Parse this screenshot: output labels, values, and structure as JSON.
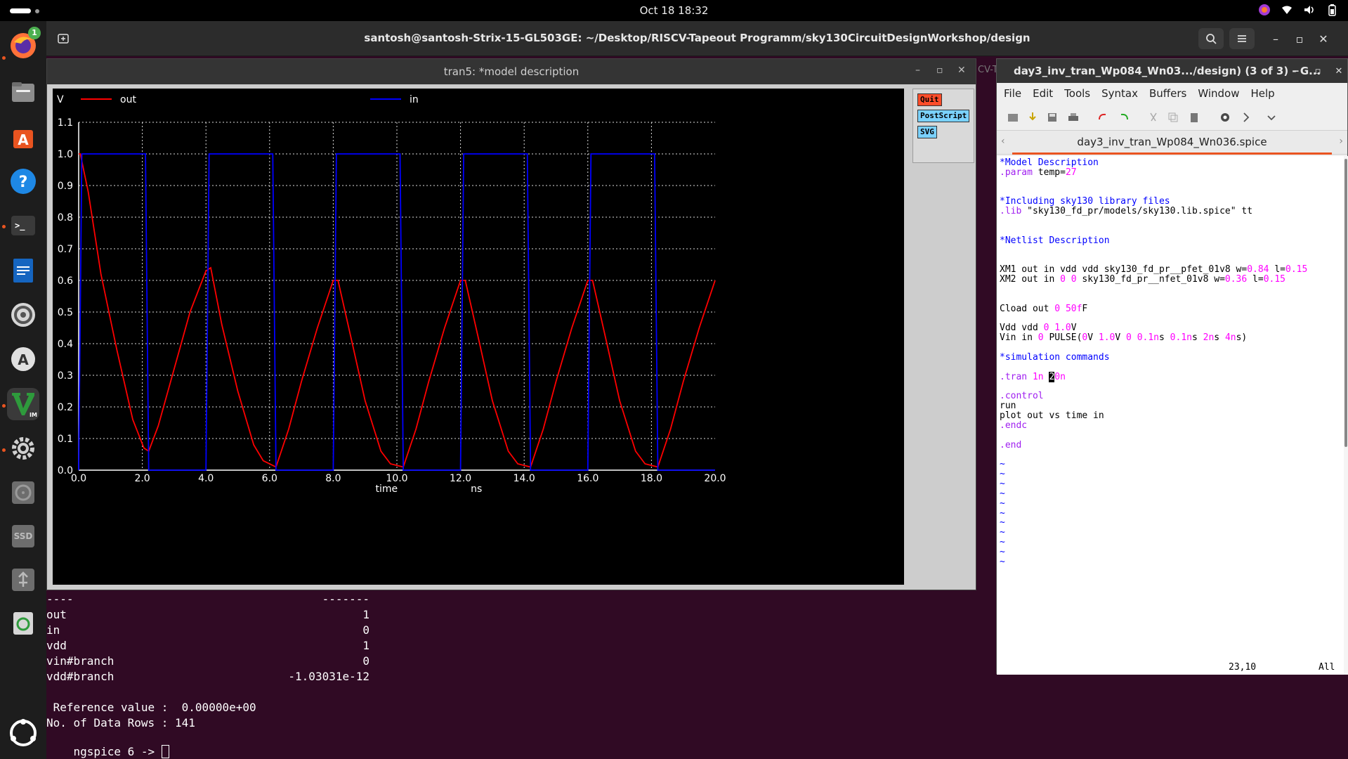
{
  "topbar": {
    "clock": "Oct 18  18:32",
    "tray_icons": [
      "firefox-indicator-icon",
      "wifi-icon",
      "volume-icon",
      "battery-icon"
    ]
  },
  "dock": {
    "items": [
      {
        "name": "firefox",
        "badge": "1"
      },
      {
        "name": "files"
      },
      {
        "name": "software-center"
      },
      {
        "name": "help"
      },
      {
        "name": "terminal"
      },
      {
        "name": "libreoffice-writer"
      },
      {
        "name": "settings-wheel"
      },
      {
        "name": "software-updater"
      },
      {
        "name": "vim"
      },
      {
        "name": "settings"
      },
      {
        "name": "disk"
      },
      {
        "name": "ssd",
        "label": "SSD"
      },
      {
        "name": "usb-drive"
      },
      {
        "name": "trash"
      },
      {
        "name": "show-apps"
      }
    ]
  },
  "terminal": {
    "title": "santosh@santosh-Strix-15-GL503GE: ~/Desktop/RISCV-Tapeout Programm/sky130CircuitDesignWorkshop/design",
    "behind_tab_fragment": "CV-T",
    "output": [
      {
        "name": "----",
        "value": "-------"
      },
      {
        "name": "out",
        "value": "1"
      },
      {
        "name": "in",
        "value": "0"
      },
      {
        "name": "vdd",
        "value": "1"
      },
      {
        "name": "vin#branch",
        "value": "0"
      },
      {
        "name": "vdd#branch",
        "value": "-1.03031e-12"
      }
    ],
    "reference_line": " Reference value :  0.00000e+00",
    "rows_line": "No. of Data Rows : 141",
    "prompt": "ngspice 6 -> "
  },
  "plot_window": {
    "title": "tran5: *model description",
    "buttons": {
      "quit": "Quit",
      "postscript": "PostScript",
      "svg": "SVG"
    }
  },
  "chart_data": {
    "type": "line",
    "ylabel": "V",
    "xlabel": "time",
    "xunit": "ns",
    "xlim": [
      0,
      20
    ],
    "ylim": [
      0,
      1.1
    ],
    "xticks": [
      "0.0",
      "2.0",
      "4.0",
      "6.0",
      "8.0",
      "10.0",
      "12.0",
      "14.0",
      "16.0",
      "18.0",
      "20.0"
    ],
    "yticks": [
      "0.0",
      "0.1",
      "0.2",
      "0.3",
      "0.4",
      "0.5",
      "0.6",
      "0.7",
      "0.8",
      "0.9",
      "1.0",
      "1.1"
    ],
    "grid": true,
    "legend_placement": "top",
    "series": [
      {
        "name": "out",
        "color": "#ff0000",
        "x": [
          0.0,
          0.05,
          0.3,
          0.7,
          1.2,
          1.7,
          2.05,
          2.2,
          2.5,
          3.0,
          3.5,
          4.0,
          4.15,
          4.5,
          5.0,
          5.5,
          5.8,
          6.2,
          6.6,
          7.0,
          7.5,
          8.0,
          8.15,
          8.6,
          9.0,
          9.5,
          9.8,
          10.2,
          10.6,
          11.0,
          11.5,
          12.0,
          12.15,
          12.6,
          13.0,
          13.5,
          13.8,
          14.2,
          14.6,
          15.0,
          15.5,
          16.0,
          16.15,
          16.6,
          17.0,
          17.5,
          17.8,
          18.2,
          18.6,
          19.0,
          19.5,
          20.0
        ],
        "y": [
          1.0,
          1.0,
          0.88,
          0.62,
          0.38,
          0.16,
          0.07,
          0.06,
          0.14,
          0.32,
          0.5,
          0.63,
          0.64,
          0.46,
          0.25,
          0.08,
          0.03,
          0.01,
          0.13,
          0.28,
          0.45,
          0.6,
          0.6,
          0.4,
          0.22,
          0.06,
          0.02,
          0.01,
          0.13,
          0.28,
          0.45,
          0.6,
          0.6,
          0.4,
          0.22,
          0.06,
          0.02,
          0.01,
          0.13,
          0.28,
          0.45,
          0.6,
          0.6,
          0.4,
          0.22,
          0.06,
          0.02,
          0.01,
          0.13,
          0.28,
          0.45,
          0.6
        ]
      },
      {
        "name": "in",
        "color": "#0000ff",
        "x": [
          0.0,
          0.1,
          2.1,
          2.2,
          4.0,
          4.1,
          6.1,
          6.2,
          8.0,
          8.1,
          10.1,
          10.2,
          12.0,
          12.1,
          14.1,
          14.2,
          16.0,
          16.1,
          18.1,
          18.2,
          20.0
        ],
        "y": [
          0.0,
          1.0,
          1.0,
          0.0,
          0.0,
          1.0,
          1.0,
          0.0,
          0.0,
          1.0,
          1.0,
          0.0,
          0.0,
          1.0,
          1.0,
          0.0,
          0.0,
          1.0,
          1.0,
          0.0,
          0.0
        ]
      }
    ]
  },
  "vim": {
    "title": "day3_inv_tran_Wp084_Wn03.../design) (3 of 3) - G...",
    "menu": [
      "File",
      "Edit",
      "Tools",
      "Syntax",
      "Buffers",
      "Window",
      "Help"
    ],
    "tab": "day3_inv_tran_Wp084_Wn036.spice",
    "status_pos": "23,10",
    "status_all": "All",
    "lines": [
      {
        "row": 0,
        "segs": [
          {
            "t": "*Model Description",
            "c": "c-com"
          }
        ]
      },
      {
        "row": 1,
        "segs": [
          {
            "t": ".param",
            "c": "c-kw"
          },
          {
            "t": " temp="
          },
          {
            "t": "27",
            "c": "c-num"
          }
        ]
      },
      {
        "row": 4,
        "segs": [
          {
            "t": "*Including sky130 library files",
            "c": "c-com"
          }
        ]
      },
      {
        "row": 5,
        "segs": [
          {
            "t": ".lib",
            "c": "c-kw"
          },
          {
            "t": " \"sky130_fd_pr/models/sky130.lib.spice\" tt"
          }
        ]
      },
      {
        "row": 8,
        "segs": [
          {
            "t": "*Netlist Description",
            "c": "c-com"
          }
        ]
      },
      {
        "row": 11,
        "segs": [
          {
            "t": "XM1 out in vdd vdd sky130_fd_pr__pfet_01v8 w="
          },
          {
            "t": "0.84",
            "c": "c-num"
          },
          {
            "t": " l="
          },
          {
            "t": "0.15",
            "c": "c-num"
          }
        ]
      },
      {
        "row": 12,
        "segs": [
          {
            "t": "XM2 out in "
          },
          {
            "t": "0",
            "c": "c-num"
          },
          {
            "t": " "
          },
          {
            "t": "0",
            "c": "c-num"
          },
          {
            "t": " sky130_fd_pr__nfet_01v8 w="
          },
          {
            "t": "0.36",
            "c": "c-num"
          },
          {
            "t": " l="
          },
          {
            "t": "0.15",
            "c": "c-num"
          }
        ]
      },
      {
        "row": 15,
        "segs": [
          {
            "t": "Cload out "
          },
          {
            "t": "0",
            "c": "c-num"
          },
          {
            "t": " "
          },
          {
            "t": "50f",
            "c": "c-num"
          },
          {
            "t": "F"
          }
        ]
      },
      {
        "row": 17,
        "segs": [
          {
            "t": "Vdd vdd "
          },
          {
            "t": "0",
            "c": "c-num"
          },
          {
            "t": " "
          },
          {
            "t": "1.0",
            "c": "c-num"
          },
          {
            "t": "V"
          }
        ]
      },
      {
        "row": 18,
        "segs": [
          {
            "t": "Vin in "
          },
          {
            "t": "0",
            "c": "c-num"
          },
          {
            "t": " PULSE("
          },
          {
            "t": "0",
            "c": "c-num"
          },
          {
            "t": "V "
          },
          {
            "t": "1.0",
            "c": "c-num"
          },
          {
            "t": "V "
          },
          {
            "t": "0",
            "c": "c-num"
          },
          {
            "t": " "
          },
          {
            "t": "0.1n",
            "c": "c-num"
          },
          {
            "t": "s "
          },
          {
            "t": "0.1n",
            "c": "c-num"
          },
          {
            "t": "s "
          },
          {
            "t": "2n",
            "c": "c-num"
          },
          {
            "t": "s "
          },
          {
            "t": "4n",
            "c": "c-num"
          },
          {
            "t": "s)"
          }
        ]
      },
      {
        "row": 20,
        "segs": [
          {
            "t": "*simulation commands",
            "c": "c-com"
          }
        ]
      },
      {
        "row": 22,
        "segs": [
          {
            "t": ".tran",
            "c": "c-kw"
          },
          {
            "t": " "
          },
          {
            "t": "1n",
            "c": "c-num"
          },
          {
            "t": " "
          },
          {
            "t": "2",
            "c": "cursor"
          },
          {
            "t": "0n",
            "c": "c-num"
          }
        ]
      },
      {
        "row": 24,
        "segs": [
          {
            "t": ".control",
            "c": "c-kw"
          }
        ]
      },
      {
        "row": 25,
        "segs": [
          {
            "t": "run"
          }
        ]
      },
      {
        "row": 26,
        "segs": [
          {
            "t": "plot out vs time in"
          }
        ]
      },
      {
        "row": 27,
        "segs": [
          {
            "t": ".endc",
            "c": "c-kw"
          }
        ]
      },
      {
        "row": 29,
        "segs": [
          {
            "t": ".end",
            "c": "c-kw"
          }
        ]
      },
      {
        "row": 31,
        "segs": [
          {
            "t": "~",
            "c": "c-tilde"
          }
        ]
      },
      {
        "row": 32,
        "segs": [
          {
            "t": "~",
            "c": "c-tilde"
          }
        ]
      },
      {
        "row": 33,
        "segs": [
          {
            "t": "~",
            "c": "c-tilde"
          }
        ]
      },
      {
        "row": 34,
        "segs": [
          {
            "t": "~",
            "c": "c-tilde"
          }
        ]
      },
      {
        "row": 35,
        "segs": [
          {
            "t": "~",
            "c": "c-tilde"
          }
        ]
      },
      {
        "row": 36,
        "segs": [
          {
            "t": "~",
            "c": "c-tilde"
          }
        ]
      },
      {
        "row": 37,
        "segs": [
          {
            "t": "~",
            "c": "c-tilde"
          }
        ]
      },
      {
        "row": 38,
        "segs": [
          {
            "t": "~",
            "c": "c-tilde"
          }
        ]
      },
      {
        "row": 39,
        "segs": [
          {
            "t": "~",
            "c": "c-tilde"
          }
        ]
      },
      {
        "row": 40,
        "segs": [
          {
            "t": "~",
            "c": "c-tilde"
          }
        ]
      },
      {
        "row": 41,
        "segs": [
          {
            "t": "~",
            "c": "c-tilde"
          }
        ]
      }
    ]
  }
}
